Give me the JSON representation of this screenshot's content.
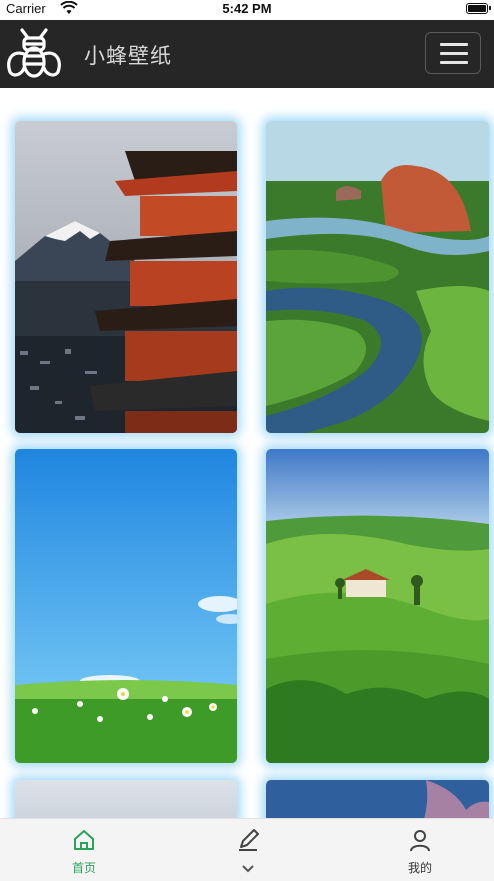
{
  "status_bar": {
    "carrier": "Carrier",
    "time": "5:42 PM"
  },
  "header": {
    "app_title": "小蜂壁纸",
    "logo_icon": "bee-logo-icon",
    "menu_icon": "hamburger-menu-icon"
  },
  "wallpapers": [
    {
      "name": "wallpaper-fuji-pagoda"
    },
    {
      "name": "wallpaper-river-delta"
    },
    {
      "name": "wallpaper-sky-meadow"
    },
    {
      "name": "wallpaper-green-hills"
    },
    {
      "name": "wallpaper-partial-5"
    },
    {
      "name": "wallpaper-partial-6"
    }
  ],
  "tab_bar": {
    "tabs": [
      {
        "label": "首页",
        "icon": "home-icon",
        "active": true
      },
      {
        "label": "",
        "icon": "pen-icon",
        "active": false
      },
      {
        "label": "我的",
        "icon": "user-icon",
        "active": false
      }
    ]
  },
  "colors": {
    "accent": "#2aa35a",
    "header_bg": "#262626",
    "card_glow": "#78c8f5"
  }
}
